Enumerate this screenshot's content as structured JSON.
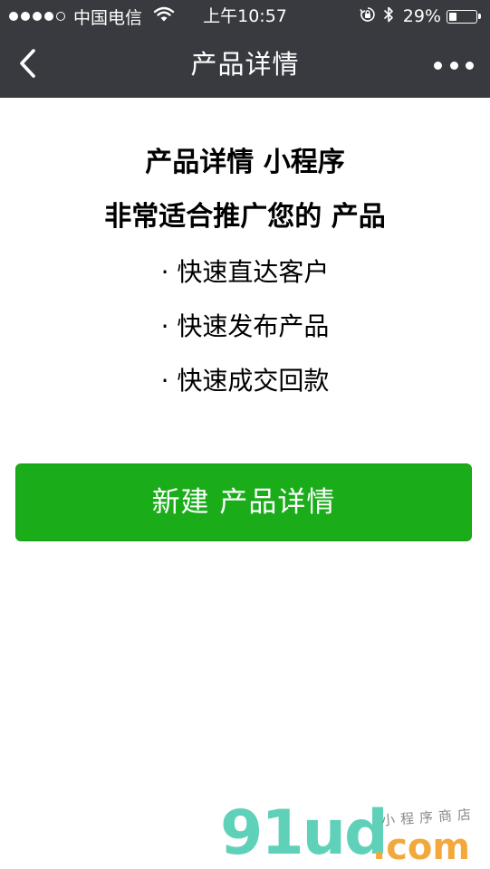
{
  "status_bar": {
    "carrier": "中国电信",
    "time": "上午10:57",
    "battery_percent_text": "29%",
    "battery_level": 0.29,
    "signal_bars_filled": 4,
    "signal_bars_total": 5
  },
  "nav": {
    "title": "产品详情"
  },
  "main": {
    "headline": "产品详情 小程序",
    "subheadline": "非常适合推广您的 产品",
    "features": [
      "· 快速直达客户",
      "· 快速发布产品",
      "· 快速成交回款"
    ],
    "create_button_label": "新建 产品详情"
  },
  "watermark": {
    "logo": "91ud",
    "domain": ".com",
    "tagline": "小程序商店"
  },
  "colors": {
    "nav_background": "#393a3f",
    "primary_green": "#1aad19",
    "watermark_teal": "#5fd1b8",
    "watermark_orange": "#f3a83b"
  }
}
